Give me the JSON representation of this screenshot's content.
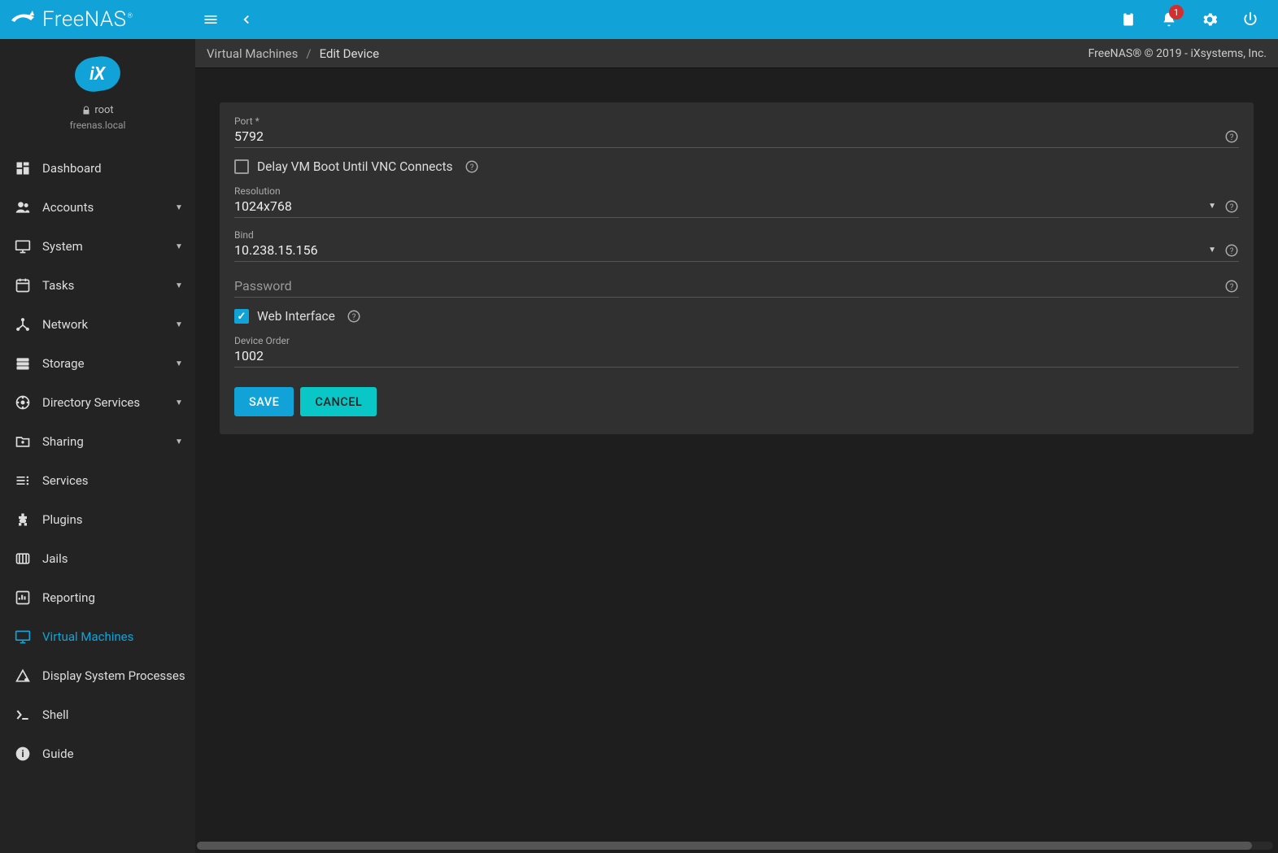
{
  "app": {
    "name": "FreeNAS"
  },
  "topbar": {
    "notification_count": "1"
  },
  "user": {
    "name": "root",
    "host": "freenas.local"
  },
  "sidebar": {
    "items": [
      {
        "icon": "dashboard",
        "label": "Dashboard",
        "expandable": false
      },
      {
        "icon": "accounts",
        "label": "Accounts",
        "expandable": true
      },
      {
        "icon": "system",
        "label": "System",
        "expandable": true
      },
      {
        "icon": "tasks",
        "label": "Tasks",
        "expandable": true
      },
      {
        "icon": "network",
        "label": "Network",
        "expandable": true
      },
      {
        "icon": "storage",
        "label": "Storage",
        "expandable": true
      },
      {
        "icon": "directory",
        "label": "Directory Services",
        "expandable": true
      },
      {
        "icon": "sharing",
        "label": "Sharing",
        "expandable": true
      },
      {
        "icon": "services",
        "label": "Services",
        "expandable": false
      },
      {
        "icon": "plugins",
        "label": "Plugins",
        "expandable": false
      },
      {
        "icon": "jails",
        "label": "Jails",
        "expandable": false
      },
      {
        "icon": "reporting",
        "label": "Reporting",
        "expandable": false
      },
      {
        "icon": "vm",
        "label": "Virtual Machines",
        "expandable": false,
        "active": true
      },
      {
        "icon": "processes",
        "label": "Display System Processes",
        "expandable": false
      },
      {
        "icon": "shell",
        "label": "Shell",
        "expandable": false
      },
      {
        "icon": "guide",
        "label": "Guide",
        "expandable": false
      }
    ]
  },
  "breadcrumb": {
    "parent": "Virtual Machines",
    "current": "Edit Device"
  },
  "footer_brand": "FreeNAS® © 2019 - iXsystems, Inc.",
  "form": {
    "port": {
      "label": "Port *",
      "value": "5792"
    },
    "delay_vnc": {
      "label": "Delay VM Boot Until VNC Connects",
      "checked": false
    },
    "resolution": {
      "label": "Resolution",
      "value": "1024x768"
    },
    "bind": {
      "label": "Bind",
      "value": "10.238.15.156"
    },
    "password": {
      "label": "Password",
      "value": "",
      "placeholder": "Password"
    },
    "web_interface": {
      "label": "Web Interface",
      "checked": true
    },
    "device_order": {
      "label": "Device Order",
      "value": "1002"
    },
    "save_label": "SAVE",
    "cancel_label": "CANCEL"
  }
}
